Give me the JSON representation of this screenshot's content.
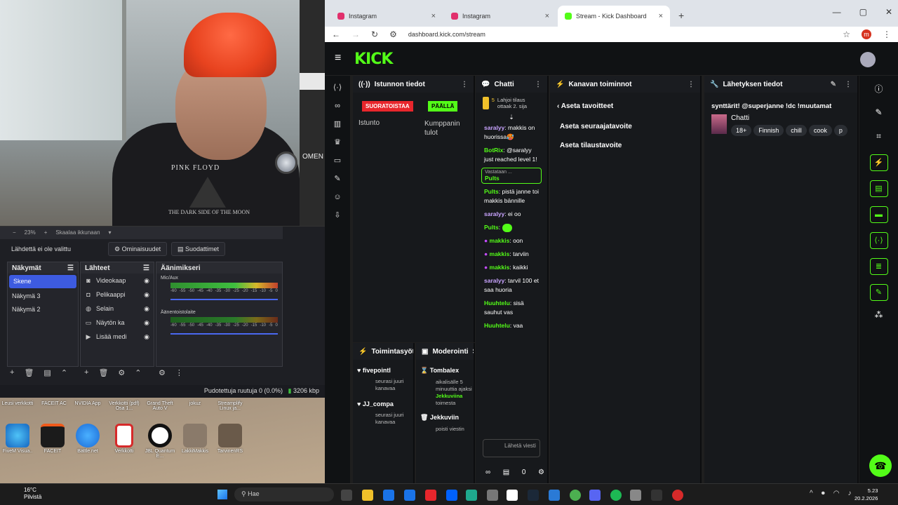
{
  "webcam": {
    "shirt_line1": "PINK FLOYD",
    "shirt_line2": "THE DARK SIDE OF THE MOON"
  },
  "omen_label": "OMEN",
  "obs": {
    "zoom": "23%",
    "scale_label": "Skaalaa ikkunaan",
    "no_source": "Lähdettä ei ole valittu",
    "properties": "Ominaisuudet",
    "filters": "Suodattimet",
    "scenes_title": "Näkymät",
    "scenes": [
      "Skene",
      "Näkymä 3",
      "Näkymä 2"
    ],
    "sources_title": "Lähteet",
    "sources": [
      "Videokaap",
      "Pelikaappi",
      "Selain",
      "Näytön ka",
      "Lisää medi"
    ],
    "mixer_title": "Äänimikseri",
    "mixer": [
      {
        "name": "Mic/Aux"
      },
      {
        "name": "Äänentoistolaite"
      }
    ],
    "ticks": [
      "-60",
      "-55",
      "-50",
      "-45",
      "-40",
      "-35",
      "-30",
      "-25",
      "-20",
      "-15",
      "-10",
      "-5",
      "0"
    ],
    "status": "Pudotettuja ruutuja 0 (0.0%)",
    "bitrate": "3206 kbp"
  },
  "desktop_icons_top": [
    "Leusi verkkotti",
    "FACEIT AC",
    "NVIDIA App",
    "Verkkotti (pdf) Osa 1...",
    "Grand Theft Auto V",
    "jokuz",
    "Streamplify Linux ja..."
  ],
  "desktop_icons": [
    {
      "label": "FiveM Visua..",
      "color": "#2a7ad6"
    },
    {
      "label": "FACEIT",
      "color": "#f05a1a"
    },
    {
      "label": "Battle.net",
      "color": "#1a8ae8"
    },
    {
      "label": "Verkkotti",
      "color": "#d62a2a"
    },
    {
      "label": "JBL Quantum E...",
      "color": "#e8e8e8"
    },
    {
      "label": "LakkiMakkis",
      "color": "#8a7a6a"
    },
    {
      "label": "TarvinenRS",
      "color": "#6a5a4a"
    }
  ],
  "browser": {
    "tabs": [
      {
        "title": "Instagram",
        "color": "#e1306c"
      },
      {
        "title": "Instagram",
        "color": "#e1306c"
      },
      {
        "title": "Stream - Kick Dashboard",
        "color": "#53fc18"
      }
    ],
    "url": "dashboard.kick.com/stream",
    "profile_initial": "m"
  },
  "kick": {
    "logo": "KICK",
    "session": {
      "title": "Istunnon tiedot",
      "live_badge": "SUORATOISTAA",
      "on_badge": "PÄÄLLÄ",
      "session_label": "Istunto",
      "partner_label": "Kumppanin tulot"
    },
    "chat": {
      "title": "Chatti",
      "gift": {
        "count": "5",
        "text": "Lahjoi tilaus ottaak 2. sija"
      },
      "reply_label": "Vastataan ...",
      "messages": [
        {
          "user": "saralyy",
          "color": "#c9a4ff",
          "text": "makkis on huorissa🥵"
        },
        {
          "user": "BotRix",
          "color": "#53fc18",
          "text": "@saralyy just reached level 1!"
        },
        {
          "user": "Pults",
          "color": "#53fc18",
          "text": "pistä janne toi makkis bännille"
        },
        {
          "user": "saralyy",
          "color": "#c9a4ff",
          "text": "ei oo"
        },
        {
          "user": "Pults",
          "color": "#53fc18",
          "text": ""
        },
        {
          "user": "makkis",
          "color": "#53fc18",
          "text": "oon"
        },
        {
          "user": "makkis",
          "color": "#53fc18",
          "text": "tarviin"
        },
        {
          "user": "makkis",
          "color": "#53fc18",
          "text": "kaikki"
        },
        {
          "user": "saralyy",
          "color": "#c9a4ff",
          "text": "tarvil 100 et saa huoria"
        },
        {
          "user": "Huuhtelu",
          "color": "#53fc18",
          "text": "sisä sauhut vas"
        },
        {
          "user": "Huuhtelu",
          "color": "#53fc18",
          "text": "vaa"
        }
      ],
      "input_placeholder": "Lähetä viesti",
      "footer_count": "0"
    },
    "actions": {
      "title": "Kanavan toiminnot",
      "back": "Aseta tavoitteet",
      "items": [
        "Aseta seuraajatavoite",
        "Aseta tilaustavoite"
      ]
    },
    "broadcast": {
      "title": "Lähetyksen tiedot",
      "stream_title": "synttärit! @superjanne !dc !muutamat",
      "category": "Chatti",
      "tags": [
        "18+",
        "Finnish",
        "chill",
        "cook",
        "p"
      ]
    },
    "activity": {
      "title": "Toimintasyöte",
      "items": [
        {
          "user": "fivepointl",
          "text": "seurasi juuri kanavaa"
        },
        {
          "user": "JJ_compa",
          "text": "seurasi juuri kanavaa"
        }
      ]
    },
    "moderation": {
      "title": "Moderointi",
      "tab_more": "Su",
      "items": [
        {
          "user": "Tombalex",
          "text": "aikalisälle 5 minuuttia ajaksi",
          "by": "Jekkuviina",
          "by_suffix": "toimesta"
        },
        {
          "user": "Jekkuviin",
          "text": "poisti viestin"
        }
      ]
    }
  },
  "taskbar": {
    "weather_temp": "16°C",
    "weather_desc": "Pilvistä",
    "search": "Hae",
    "time": "5.23",
    "date": "20.2.2026"
  }
}
